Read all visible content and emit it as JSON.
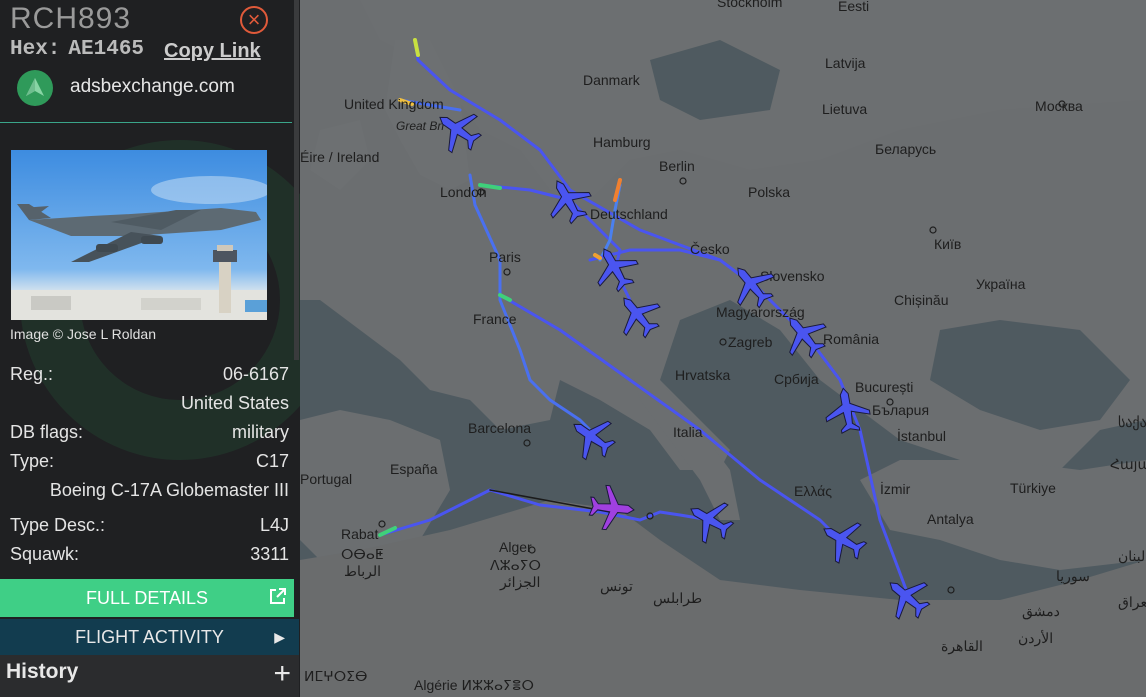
{
  "sidebar": {
    "callsign": "RCH893",
    "hex_label": "Hex:",
    "hex_value": "AE1465",
    "copy_link": "Copy Link",
    "site_name": "adsbexchange.com",
    "image_credit": "Image © Jose L Roldan",
    "rows": [
      {
        "label": "Reg.:",
        "value": "06-6167"
      },
      {
        "label": "",
        "value": "United States"
      },
      {
        "label": "DB flags:",
        "value": "military"
      },
      {
        "label": "Type:",
        "value": "C17"
      },
      {
        "label": "",
        "value": "Boeing C-17A Globemaster III"
      },
      {
        "label": "Type Desc.:",
        "value": "L4J"
      },
      {
        "label": "Squawk:",
        "value": "3311"
      }
    ],
    "full_details_label": "FULL DETAILS",
    "flight_activity_label": "FLIGHT ACTIVITY",
    "history_label": "History",
    "close_icon": "close-icon",
    "accent_green": "#3fcf86",
    "accent_teal": "#123c4f"
  },
  "map": {
    "labels": {
      "stockholm": "Stockholm",
      "eesti": "Eesti",
      "latvija": "Latvija",
      "danmark": "Danmark",
      "lietuva": "Lietuva",
      "moskva": "Москва",
      "united_kingdom": "United Kingdom",
      "great_britain": "Great Bri",
      "ireland": "Éire / Ireland",
      "hamburg": "Hamburg",
      "berlin": "Berlin",
      "belarus": "Беларусь",
      "london": "London",
      "polska": "Polska",
      "deutschland": "Deutschland",
      "kyiv": "Київ",
      "cesko": "Česko",
      "paris": "Paris",
      "slovensko": "Slovensko",
      "ukraina": "Україна",
      "france": "France",
      "chisinau": "Chișinău",
      "magyarorszag": "Magyarország",
      "zagreb": "Zagreb",
      "romania": "România",
      "hrvatska": "Hrvatska",
      "srbija": "Србија",
      "bucuresti": "București",
      "bulgaria": "Бъларuя",
      "barcelona": "Barcelona",
      "italia": "Italia",
      "istanbul": "İstanbul",
      "georgia": "საქა",
      "portugal": "Portugal",
      "espana": "España",
      "hellas": "Ελλάς",
      "izmir": "İzmir",
      "turkiye": "Türkiye",
      "armenia": "Հայաս",
      "antalya": "Antalya",
      "rabat": "Rabat",
      "rabat_tif": "ⵔⴱⴰⵟ",
      "rabat_ar": "الرباط",
      "alger": "Alger",
      "alger_tif": "ⴷⵣⴰⵢⵔ",
      "alger_ar": "الجزائر",
      "tunis": "تونس",
      "tripoli": "طرابلس",
      "syria": "سوريا",
      "damascus": "دمشق",
      "jordan": "الأردن",
      "cairo": "القاهرة",
      "iraq": "العراق",
      "lebanon": "لبنان",
      "maroc": "ⵍⵎⵖⵔⵉⴱ",
      "algerie": "Algérie ⵍⵣⵣⴰⵢⴻⵔ"
    },
    "selected_color": "#a040e0",
    "aircraft_color": "#4a55f0",
    "land_color": "#6b6e70",
    "sea_color": "#4f5a60"
  }
}
